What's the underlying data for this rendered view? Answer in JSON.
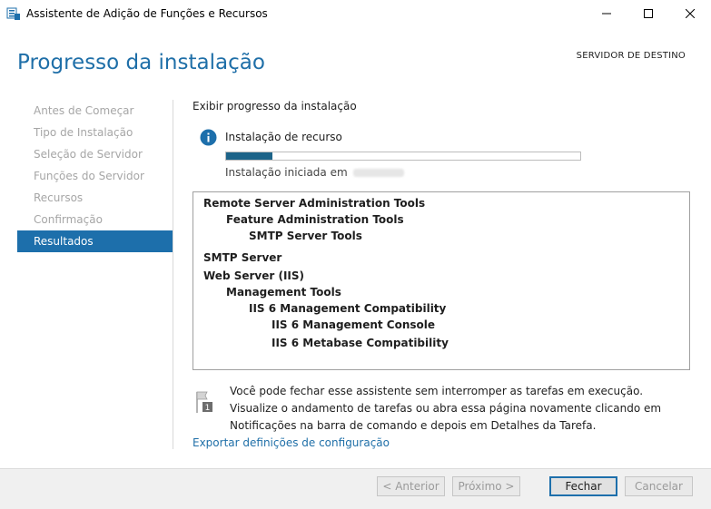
{
  "window": {
    "title": "Assistente de Adição de Funções e Recursos"
  },
  "header": {
    "title": "Progresso da instalação",
    "destination_label": "SERVIDOR DE DESTINO"
  },
  "nav": {
    "items": [
      {
        "label": "Antes de Começar"
      },
      {
        "label": "Tipo de Instalação"
      },
      {
        "label": "Seleção de Servidor"
      },
      {
        "label": "Funções do Servidor"
      },
      {
        "label": "Recursos"
      },
      {
        "label": "Confirmação"
      },
      {
        "label": "Resultados"
      }
    ],
    "active_item": "Resultados"
  },
  "content": {
    "heading": "Exibir progresso da instalação",
    "status_label": "Instalação de recurso",
    "progress_fraction": 0.13,
    "started_text": "Instalação iniciada em",
    "results": [
      {
        "label": "Remote Server Administration Tools",
        "level": 0
      },
      {
        "label": "Feature Administration Tools",
        "level": 1
      },
      {
        "label": "SMTP Server Tools",
        "level": 2
      },
      {
        "label": "SMTP Server",
        "level": 0
      },
      {
        "label": "Web Server (IIS)",
        "level": 0
      },
      {
        "label": "Management Tools",
        "level": 1
      },
      {
        "label": "IIS 6 Management Compatibility",
        "level": 2
      },
      {
        "label": "IIS 6 Management Console",
        "level": 3
      },
      {
        "label": "IIS 6 Metabase Compatibility",
        "level": 3
      }
    ],
    "notice_text": "Você pode fechar esse assistente sem interromper as tarefas em execução. Visualize o andamento de tarefas ou abra essa página novamente clicando em Notificações na barra de comando e depois em Detalhes da Tarefa.",
    "notice_badge": "1",
    "export_link": "Exportar definições de configuração"
  },
  "buttons": {
    "previous": "< Anterior",
    "next": "Próximo >",
    "close": "Fechar",
    "cancel": "Cancelar"
  },
  "colors": {
    "accent": "#1d6fab",
    "progress": "#1d6489",
    "disabled_text": "#a6a6a6"
  },
  "icons": {
    "app": "server-manager-icon",
    "info": "info-icon",
    "notice": "flag-notification-icon"
  }
}
